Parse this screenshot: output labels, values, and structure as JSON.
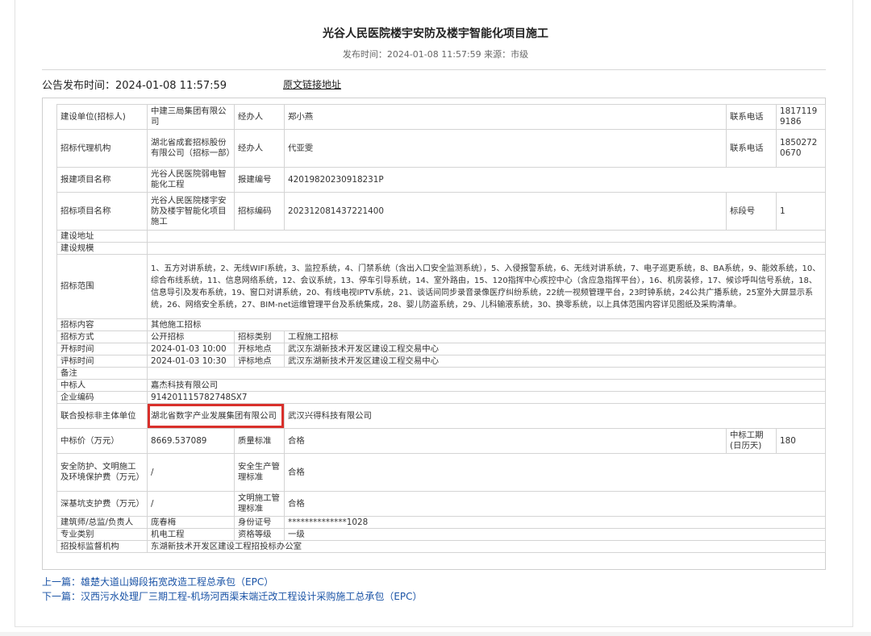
{
  "header": {
    "title": "光谷人民医院楼宇安防及楼宇智能化项目施工",
    "meta": "发布时间：2024-01-08 11:57:59 来源：市级"
  },
  "publish": {
    "label": "公告发布时间：2024-01-08 11:57:59",
    "source_link": "原文链接地址"
  },
  "table": {
    "r1": {
      "l1": "建设单位(招标人)",
      "v1": "中建三局集团有限公司",
      "l2": "经办人",
      "v2": "郑小燕",
      "l3": "联系电话",
      "v3": "18171199186"
    },
    "r2": {
      "l1": "招标代理机构",
      "v1": "湖北省成套招标股份有限公司（招标一部）",
      "l2": "经办人",
      "v2": "代亚雯",
      "l3": "联系电话",
      "v3": "18502720670"
    },
    "r3": {
      "l1": "报建项目名称",
      "v1": "光谷人民医院弱电智能化工程",
      "l2": "报建编号",
      "v2": "42019820230918231P"
    },
    "r4": {
      "l1": "招标项目名称",
      "v1": "光谷人民医院楼宇安防及楼宇智能化项目施工",
      "l2": "招标编码",
      "v2": "202312081437221400",
      "l3": "标段号",
      "v3": "1"
    },
    "r5": {
      "l1": "建设地址"
    },
    "r6": {
      "l1": "建设规模"
    },
    "r7": {
      "l1": "招标范围",
      "v1": "1、五方对讲系统，2、无线WIFI系统，3、监控系统，4、门禁系统（含出入口安全监测系统），5、入侵报警系统，6、无线对讲系统，7、电子巡更系统，8、BA系统，9、能效系统，10、综合布线系统，11、信息网络系统，12、会议系统，13、停车引导系统，14、室外路由，15、120指挥中心疾控中心（含应急指挥平台），16、机房装修，17、候诊呼叫信号系统，18、信息导引及发布系统，19、窗口对讲系统，20、有线电视IPTV系统，21、谈话间同步录音录像医疗纠纷系统，22统一视频管理平台，23时钟系统，24公共广播系统，25室外大屏显示系统，26、网络安全系统，27、BIM-net运维管理平台及系统集成，28、婴儿防盗系统，29、儿科输液系统，30、换零系统，以上具体范围内容详见图纸及采购清单。"
    },
    "r8": {
      "l1": "招标内容",
      "v1": "其他施工招标"
    },
    "r9": {
      "l1": "招标方式",
      "v1": "公开招标",
      "l2": "招标类别",
      "v2": "工程施工招标"
    },
    "r10": {
      "l1": "开标时间",
      "v1": "2024-01-03 10:00",
      "l2": "开标地点",
      "v2": "武汉东湖新技术开发区建设工程交易中心"
    },
    "r11": {
      "l1": "评标时间",
      "v1": "2024-01-03 10:30",
      "l2": "评标地点",
      "v2": "武汉东湖新技术开发区建设工程交易中心"
    },
    "r12": {
      "l1": "备注"
    },
    "r13": {
      "l1": "中标人",
      "v1": "嘉杰科技有限公司"
    },
    "r14": {
      "l1": "企业编码",
      "v1": "914201115782748SX7"
    },
    "r15": {
      "l1": "联合投标非主体单位",
      "v1": "湖北省数字产业发展集团有限公司",
      "v2": "武汉兴得科技有限公司"
    },
    "r16": {
      "l1": "中标价（万元）",
      "v1": "8669.537089",
      "l2": "质量标准",
      "v2": "合格",
      "l3": "中标工期(日历天)",
      "v3": "180"
    },
    "r17": {
      "l1": "安全防护、文明施工及环境保护费（万元）",
      "v1": "/",
      "l2": "安全生产管理标准",
      "v2": "合格"
    },
    "r18": {
      "l1": "深基坑支护费（万元）",
      "v1": "/",
      "l2": "文明施工管理标准",
      "v2": "合格"
    },
    "r19": {
      "l1": "建筑师/总监/负责人",
      "v1": "庞春梅",
      "l2": "身份证号",
      "v2": "**************1028"
    },
    "r20": {
      "l1": "专业类别",
      "v1": "机电工程",
      "l2": "资格等级",
      "v2": "一级"
    },
    "r21": {
      "l1": "招投标监督机构",
      "v1": "东湖新技术开发区建设工程招投标办公室"
    }
  },
  "nav": {
    "prev": "上一篇：雄楚大道山姆段拓宽改造工程总承包（EPC）",
    "next": "下一篇：汉西污水处理厂三期工程-机场河西渠末端迁改工程设计采购施工总承包（EPC）"
  },
  "colors": {
    "highlight": "#d9302b",
    "link": "#1a53a6"
  }
}
